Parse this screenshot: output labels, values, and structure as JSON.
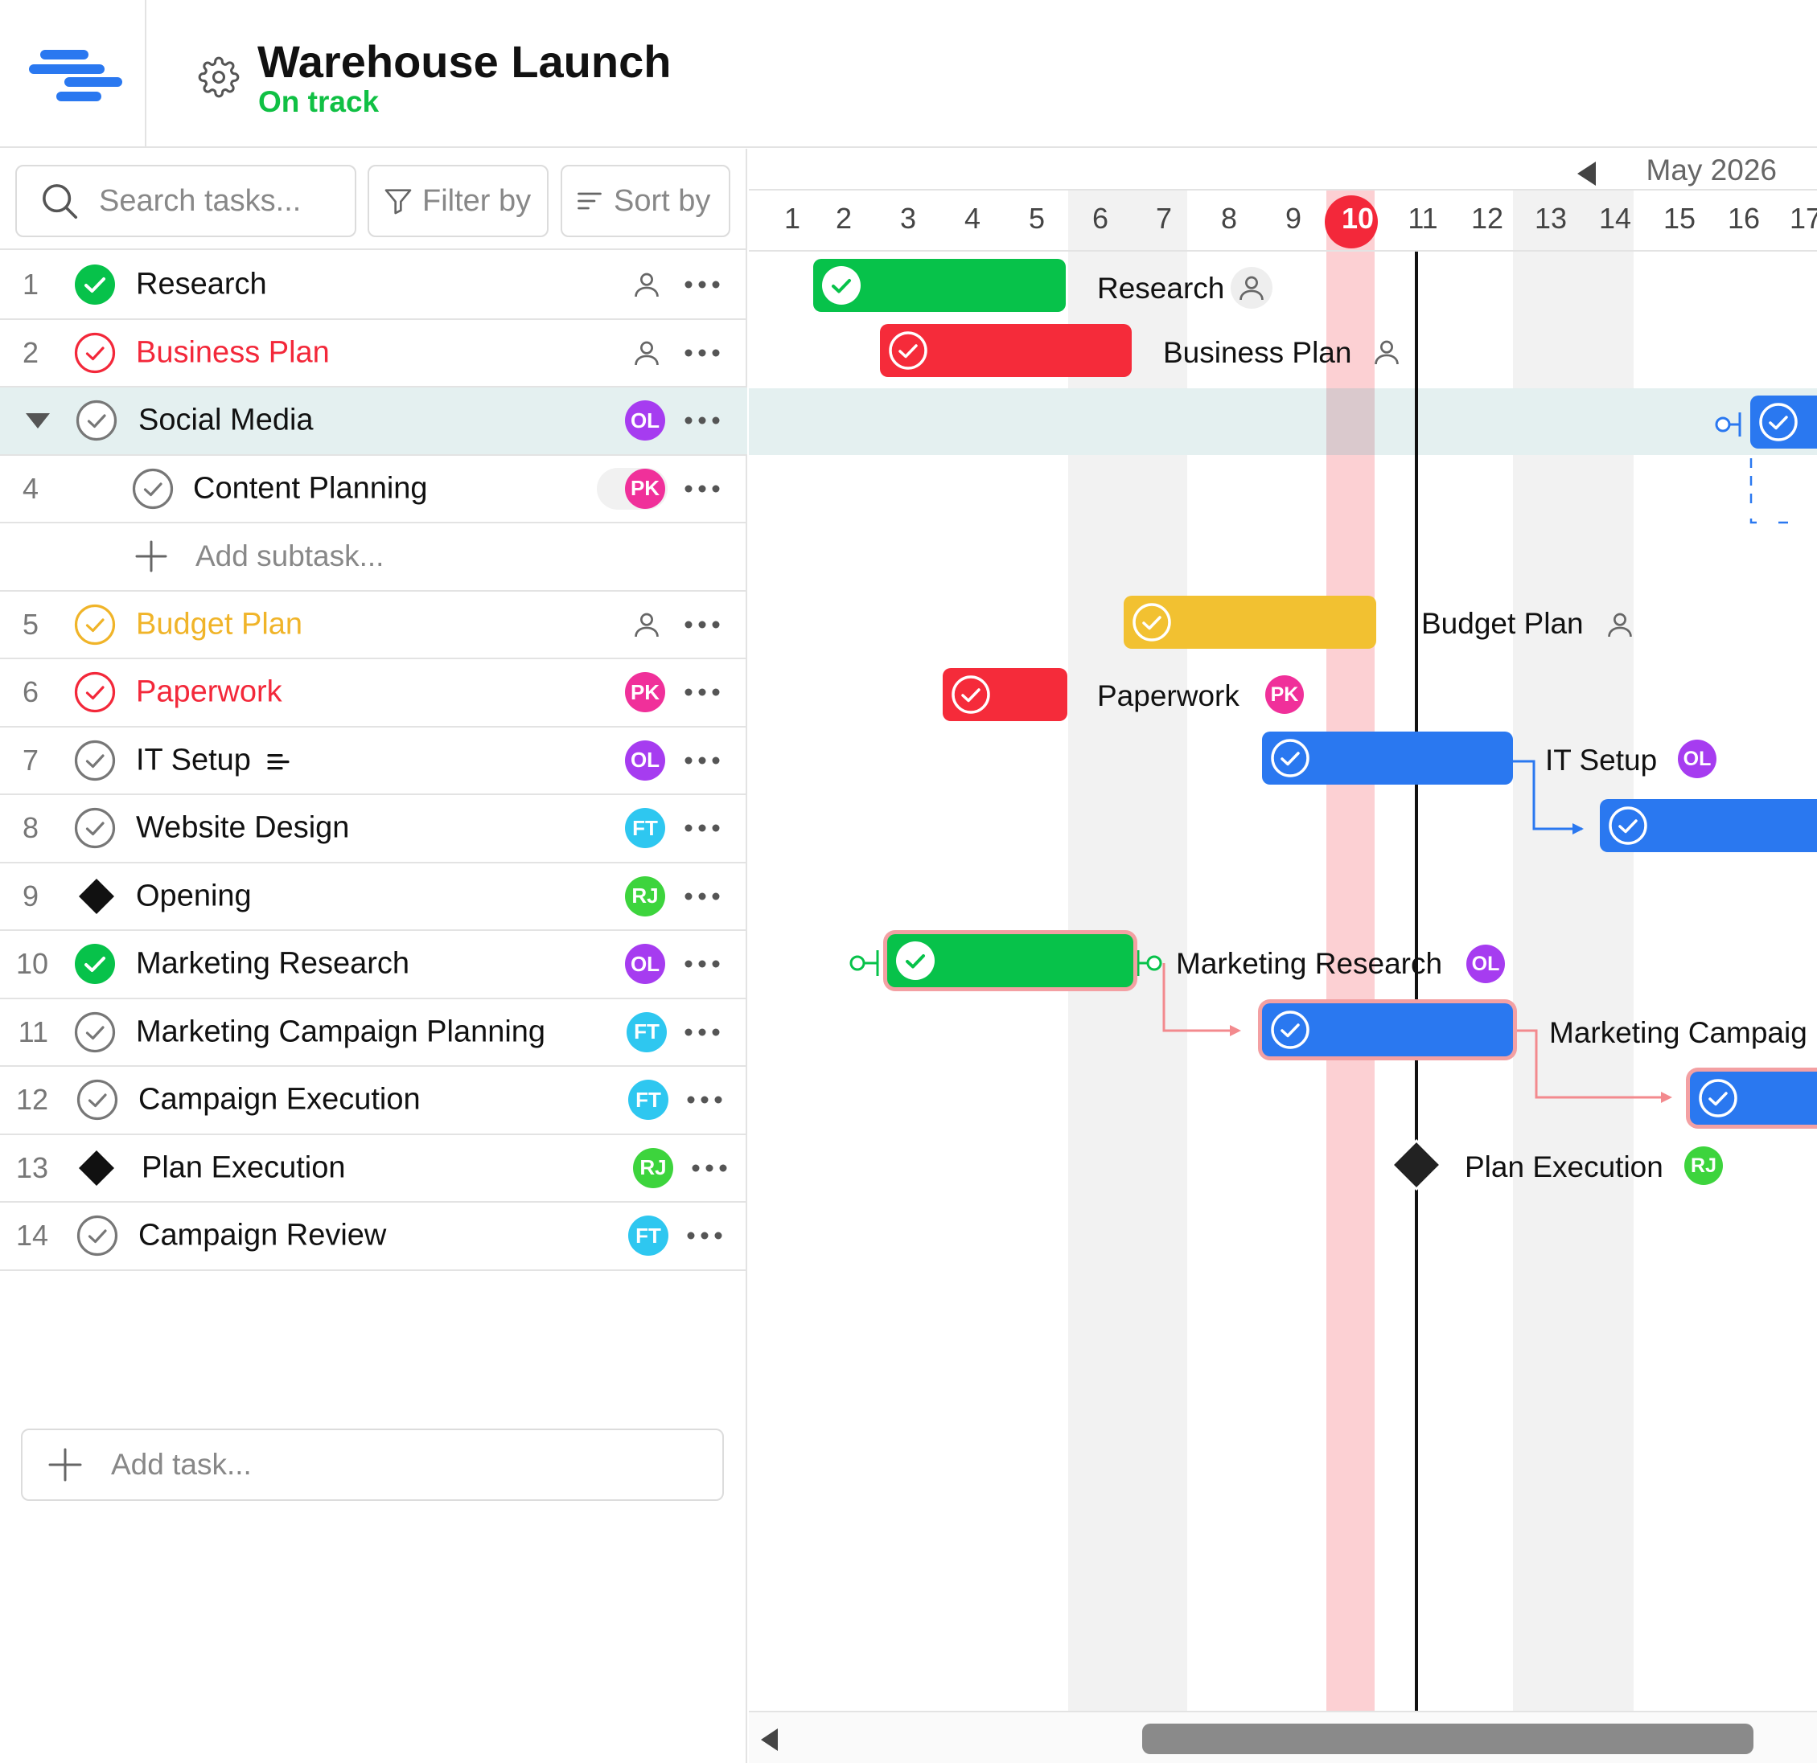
{
  "header": {
    "title": "Warehouse Launch",
    "status": "On track",
    "status_color": "#10c044",
    "logo_icon": "stacked-lines-logo",
    "settings_icon": "gear-icon"
  },
  "toolbar": {
    "search_placeholder": "Search tasks...",
    "filter_label": "Filter by",
    "sort_label": "Sort by"
  },
  "tasks": [
    {
      "num": "1",
      "name": "Research",
      "status": "done",
      "color": "#111111",
      "assignee": ""
    },
    {
      "num": "2",
      "name": "Business Plan",
      "status": "red",
      "color": "#f3283a",
      "assignee": ""
    },
    {
      "num": "",
      "name": "Social Media",
      "status": "gray",
      "color": "#111111",
      "assignee": "OL",
      "group": true
    },
    {
      "num": "4",
      "name": "Content Planning",
      "status": "gray",
      "color": "#111111",
      "assignee": "PK",
      "sub": true
    },
    {
      "num": "5",
      "name": "Budget Plan",
      "status": "yellow",
      "color": "#f0b429",
      "assignee": ""
    },
    {
      "num": "6",
      "name": "Paperwork",
      "status": "red",
      "color": "#f3283a",
      "assignee": "PK"
    },
    {
      "num": "7",
      "name": "IT Setup",
      "status": "gray",
      "color": "#111111",
      "assignee": "OL",
      "notes": true
    },
    {
      "num": "8",
      "name": "Website Design",
      "status": "gray",
      "color": "#111111",
      "assignee": "FT"
    },
    {
      "num": "9",
      "name": "Opening",
      "status": "milestone",
      "color": "#111111",
      "assignee": "RJ"
    },
    {
      "num": "10",
      "name": "Marketing Research",
      "status": "done",
      "color": "#111111",
      "assignee": "OL"
    },
    {
      "num": "11",
      "name": "Marketing Campaign Planning",
      "status": "gray",
      "color": "#111111",
      "assignee": "FT"
    },
    {
      "num": "12",
      "name": "Campaign Execution",
      "status": "gray",
      "color": "#111111",
      "assignee": "FT"
    },
    {
      "num": "13",
      "name": "Plan Execution",
      "status": "milestone",
      "color": "#111111",
      "assignee": "RJ"
    },
    {
      "num": "14",
      "name": "Campaign Review",
      "status": "gray",
      "color": "#111111",
      "assignee": "FT"
    }
  ],
  "add_subtask": "Add subtask...",
  "add_task": "Add task...",
  "avatar_colors": {
    "OL": "#a63cf0",
    "PK": "#f0309a",
    "FT": "#2ec7f0",
    "RJ": "#3dd43d"
  },
  "gantt": {
    "month": "May 2026",
    "days": [
      "1",
      "2",
      "3",
      "4",
      "5",
      "6",
      "7",
      "8",
      "9",
      "10",
      "11",
      "12",
      "13",
      "14",
      "15",
      "16",
      "17"
    ],
    "today": "10",
    "weekend_days": [
      "6",
      "7",
      "13",
      "14"
    ],
    "bars": [
      {
        "task": "Research",
        "start": 2,
        "end": 5,
        "color": "#07c24a",
        "assignee": ""
      },
      {
        "task": "Business Plan",
        "start": 3,
        "end": 6,
        "color": "#f52b3a",
        "assignee": ""
      },
      {
        "task": "Social Media",
        "start": 16,
        "end": 17,
        "color": "#2a78f0",
        "assignee": "OL"
      },
      {
        "task": "Budget Plan",
        "start": 6,
        "end": 9,
        "color": "#f2c131",
        "assignee": ""
      },
      {
        "task": "Paperwork",
        "start": 4,
        "end": 5,
        "color": "#f52b3a",
        "assignee": "PK"
      },
      {
        "task": "IT Setup",
        "start": 9,
        "end": 12,
        "color": "#2a78f0",
        "assignee": "OL"
      },
      {
        "task": "Website Design",
        "start": 14,
        "end": 17,
        "color": "#2a78f0",
        "assignee": "FT"
      },
      {
        "task": "Marketing Research",
        "start": 3,
        "end": 6,
        "color": "#07c24a",
        "assignee": "OL"
      },
      {
        "task": "Marketing Campaign Planning",
        "start": 9,
        "end": 12,
        "color": "#2a78f0",
        "assignee": "FT"
      },
      {
        "task": "Campaign Execution",
        "start": 15,
        "end": 17,
        "color": "#2a78f0",
        "assignee": "FT"
      },
      {
        "task": "Plan Execution",
        "milestone": 11,
        "color": "#222222",
        "assignee": "RJ"
      }
    ],
    "labels": {
      "research": "Research",
      "business_plan": "Business Plan",
      "budget_plan": "Budget Plan",
      "paperwork": "Paperwork",
      "it_setup": "IT Setup",
      "marketing_research": "Marketing Research",
      "marketing_campaign": "Marketing Campaig",
      "plan_execution": "Plan Execution"
    }
  }
}
